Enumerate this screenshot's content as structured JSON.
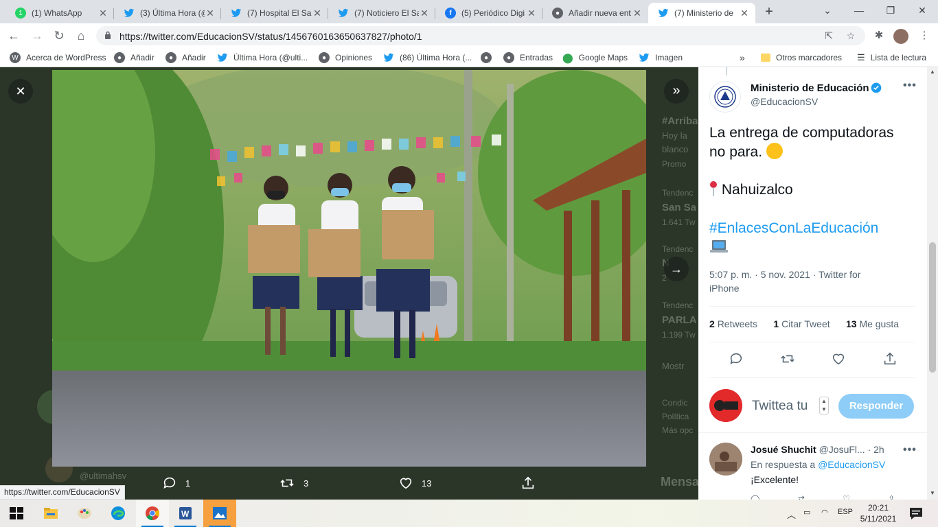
{
  "browser": {
    "tabs": [
      {
        "title": "(1) WhatsApp",
        "icon": "whatsapp-icon"
      },
      {
        "title": "(3) Última Hora (@",
        "icon": "twitter-icon"
      },
      {
        "title": "(7) Hospital El Sal",
        "icon": "twitter-icon"
      },
      {
        "title": "(7) Noticiero El Sa",
        "icon": "twitter-icon"
      },
      {
        "title": "(5) Periódico Digi",
        "icon": "facebook-icon"
      },
      {
        "title": "Añadir nueva ent",
        "icon": "globe-icon"
      },
      {
        "title": "(7) Ministerio de",
        "icon": "twitter-icon",
        "active": true
      }
    ],
    "url": "https://twitter.com/EducacionSV/status/1456760163650637827/photo/1",
    "bookmarks": [
      {
        "label": "Acerca de WordPress",
        "icon": "wordpress-icon"
      },
      {
        "label": "Añadir",
        "icon": "globe-icon"
      },
      {
        "label": "Añadir",
        "icon": "globe-icon"
      },
      {
        "label": "Última Hora (@ulti...",
        "icon": "twitter-icon"
      },
      {
        "label": "Opiniones",
        "icon": "globe-icon"
      },
      {
        "label": "(86) Última Hora (...",
        "icon": "twitter-icon"
      },
      {
        "label": "",
        "icon": "globe-icon"
      },
      {
        "label": "Entradas",
        "icon": "globe-icon"
      },
      {
        "label": "Google Maps",
        "icon": "maps-pin-icon"
      },
      {
        "label": "Imagen",
        "icon": "twitter-icon"
      }
    ],
    "bookmarks_overflow": "»",
    "other_bookmarks": "Otros marcadores",
    "reading_list": "Lista de lectura",
    "status_url": "https://twitter.com/EducacionSV"
  },
  "viewer": {
    "close_label": "✕",
    "expand_label": "»",
    "next_label": "→",
    "actions": {
      "reply_count": "1",
      "retweet_count": "3",
      "like_count": "13"
    },
    "background": {
      "hashtag": "#Arriba",
      "line1": "Hoy la",
      "line2": "blanco",
      "line3": "Promo",
      "trend1_label": "Tendenc",
      "trend1_name": "San Sa",
      "trend1_count": "1.641 Tw",
      "trend2_label": "Tendenc",
      "trend2_name": "N",
      "trend2_count": "2",
      "trend3_label": "Tendenc",
      "trend3_name": "PARLA",
      "trend3_count": "1.199 Tw",
      "show_more": "Mostr",
      "footer1": "Condic",
      "footer2": "Política",
      "footer3": "Más opc",
      "username": "@ultimahsv",
      "messages": "Mensa"
    }
  },
  "tweet": {
    "author_name": "Ministerio de Educación",
    "author_handle": "@EducacionSV",
    "more_label": "•••",
    "text_line1": "La entrega de computadoras",
    "text_line2": "no para.",
    "location": "Nahuizalco",
    "hashtag": "#EnlacesConLaEducación",
    "timestamp": "5:07 p. m. · 5 nov. 2021 · Twitter for",
    "source_line2": "iPhone",
    "retweets_count": "2",
    "retweets_label": "Retweets",
    "quotes_count": "1",
    "quotes_label": "Citar Tweet",
    "likes_count": "13",
    "likes_label": "Me gusta",
    "compose_placeholder": "Twittea tu",
    "reply_button": "Responder"
  },
  "reply": {
    "name": "Josué Shuchit",
    "handle": "@JosuFl...",
    "age": "· 2h",
    "in_reply_prefix": "En respuesta a",
    "in_reply_handle": "@EducacionSV",
    "text": "¡Excelente!",
    "more_label": "•••"
  },
  "taskbar": {
    "apps": [
      "windows-start-icon",
      "file-explorer-icon",
      "paint-icon",
      "edge-icon",
      "chrome-icon",
      "word-icon",
      "photos-icon"
    ],
    "language": "ESP",
    "time": "20:21",
    "date": "5/11/2021"
  },
  "colors": {
    "twitter_blue": "#1d9bf0",
    "reply_button": "#8ecdf8",
    "tab_strip": "#dee1e6",
    "viewer_bg": "#2b3528"
  }
}
